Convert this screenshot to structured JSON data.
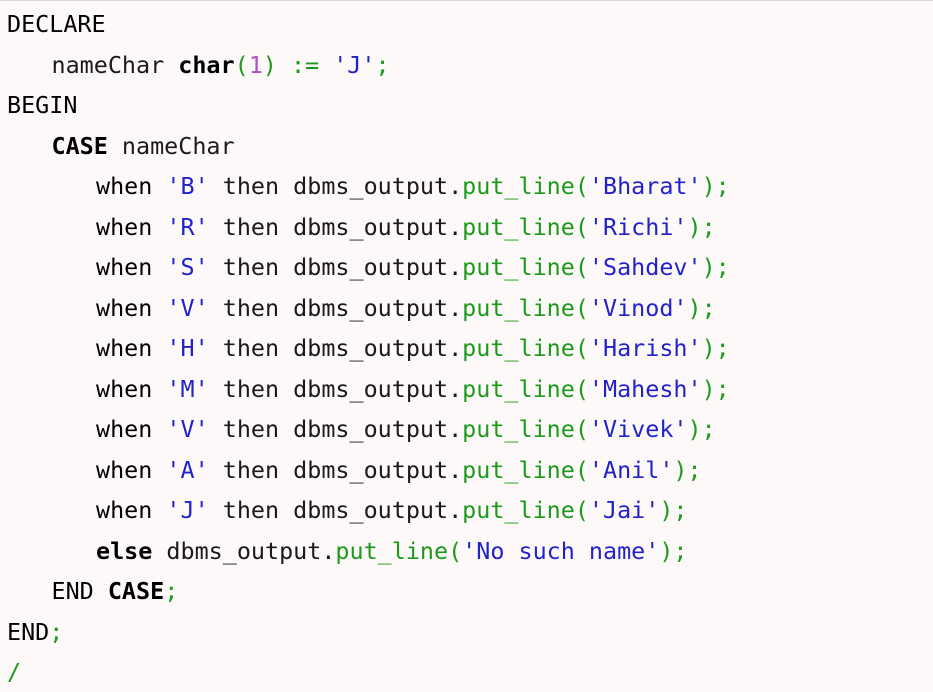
{
  "editor": {
    "lines": [
      {
        "indent": 0,
        "tokens": [
          {
            "t": "DECLARE",
            "k": "kw"
          }
        ]
      },
      {
        "indent": 1,
        "tokens": [
          {
            "t": "nameChar ",
            "k": "plain"
          },
          {
            "t": "char",
            "k": "kwb"
          },
          {
            "t": "(",
            "k": "punct"
          },
          {
            "t": "1",
            "k": "num"
          },
          {
            "t": ") := ",
            "k": "op"
          },
          {
            "t": "'J'",
            "k": "str"
          },
          {
            "t": ";",
            "k": "punct"
          }
        ]
      },
      {
        "indent": 0,
        "tokens": [
          {
            "t": "BEGIN",
            "k": "kw"
          }
        ]
      },
      {
        "indent": 1,
        "tokens": [
          {
            "t": "CASE",
            "k": "kwb"
          },
          {
            "t": " nameChar",
            "k": "plain"
          }
        ]
      },
      {
        "indent": 2,
        "tokens": [
          {
            "t": "when ",
            "k": "kw"
          },
          {
            "t": "'B'",
            "k": "str"
          },
          {
            "t": " then dbms_output.",
            "k": "plain"
          },
          {
            "t": "put_line(",
            "k": "fn"
          },
          {
            "t": "'Bharat'",
            "k": "str"
          },
          {
            "t": ");",
            "k": "punct"
          }
        ]
      },
      {
        "indent": 2,
        "tokens": [
          {
            "t": "when ",
            "k": "kw"
          },
          {
            "t": "'R'",
            "k": "str"
          },
          {
            "t": " then dbms_output.",
            "k": "plain"
          },
          {
            "t": "put_line(",
            "k": "fn"
          },
          {
            "t": "'Richi'",
            "k": "str"
          },
          {
            "t": ");",
            "k": "punct"
          }
        ]
      },
      {
        "indent": 2,
        "tokens": [
          {
            "t": "when ",
            "k": "kw"
          },
          {
            "t": "'S'",
            "k": "str"
          },
          {
            "t": " then dbms_output.",
            "k": "plain"
          },
          {
            "t": "put_line(",
            "k": "fn"
          },
          {
            "t": "'Sahdev'",
            "k": "str"
          },
          {
            "t": ");",
            "k": "punct"
          }
        ]
      },
      {
        "indent": 2,
        "tokens": [
          {
            "t": "when ",
            "k": "kw"
          },
          {
            "t": "'V'",
            "k": "str"
          },
          {
            "t": " then dbms_output.",
            "k": "plain"
          },
          {
            "t": "put_line(",
            "k": "fn"
          },
          {
            "t": "'Vinod'",
            "k": "str"
          },
          {
            "t": ");",
            "k": "punct"
          }
        ]
      },
      {
        "indent": 2,
        "tokens": [
          {
            "t": "when ",
            "k": "kw"
          },
          {
            "t": "'H'",
            "k": "str"
          },
          {
            "t": " then dbms_output.",
            "k": "plain"
          },
          {
            "t": "put_line(",
            "k": "fn"
          },
          {
            "t": "'Harish'",
            "k": "str"
          },
          {
            "t": ");",
            "k": "punct"
          }
        ]
      },
      {
        "indent": 2,
        "tokens": [
          {
            "t": "when ",
            "k": "kw"
          },
          {
            "t": "'M'",
            "k": "str"
          },
          {
            "t": " then dbms_output.",
            "k": "plain"
          },
          {
            "t": "put_line(",
            "k": "fn"
          },
          {
            "t": "'Mahesh'",
            "k": "str"
          },
          {
            "t": ");",
            "k": "punct"
          }
        ]
      },
      {
        "indent": 2,
        "tokens": [
          {
            "t": "when ",
            "k": "kw"
          },
          {
            "t": "'V'",
            "k": "str"
          },
          {
            "t": " then dbms_output.",
            "k": "plain"
          },
          {
            "t": "put_line(",
            "k": "fn"
          },
          {
            "t": "'Vivek'",
            "k": "str"
          },
          {
            "t": ");",
            "k": "punct"
          }
        ]
      },
      {
        "indent": 2,
        "tokens": [
          {
            "t": "when ",
            "k": "kw"
          },
          {
            "t": "'A'",
            "k": "str"
          },
          {
            "t": " then dbms_output.",
            "k": "plain"
          },
          {
            "t": "put_line(",
            "k": "fn"
          },
          {
            "t": "'Anil'",
            "k": "str"
          },
          {
            "t": ");",
            "k": "punct"
          }
        ]
      },
      {
        "indent": 2,
        "tokens": [
          {
            "t": "when ",
            "k": "kw"
          },
          {
            "t": "'J'",
            "k": "str"
          },
          {
            "t": " then dbms_output.",
            "k": "plain"
          },
          {
            "t": "put_line(",
            "k": "fn"
          },
          {
            "t": "'Jai'",
            "k": "str"
          },
          {
            "t": ");",
            "k": "punct"
          }
        ]
      },
      {
        "indent": 2,
        "tokens": [
          {
            "t": "else",
            "k": "kwb"
          },
          {
            "t": " dbms_output.",
            "k": "plain"
          },
          {
            "t": "put_line(",
            "k": "fn"
          },
          {
            "t": "'No such name'",
            "k": "str"
          },
          {
            "t": ");",
            "k": "punct"
          }
        ]
      },
      {
        "indent": 1,
        "tokens": [
          {
            "t": "END ",
            "k": "kw"
          },
          {
            "t": "CASE",
            "k": "kwb"
          },
          {
            "t": ";",
            "k": "punct"
          }
        ]
      },
      {
        "indent": 0,
        "tokens": [
          {
            "t": "END",
            "k": "kw"
          },
          {
            "t": ";",
            "k": "punct"
          }
        ]
      },
      {
        "indent": 0,
        "tokens": [
          {
            "t": "/",
            "k": "fn"
          }
        ]
      }
    ]
  },
  "colors": {
    "background": "#fdf9f8",
    "keyword": "#000000",
    "string": "#2222cc",
    "function": "#1d9a1d",
    "number": "#b44fc4"
  }
}
